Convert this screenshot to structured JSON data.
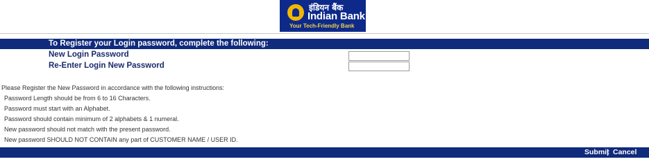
{
  "header": {
    "logo_hindi": "इंडियन बैंक",
    "logo_name": "Indian Bank",
    "logo_tagline": "Your Tech-Friendly Bank"
  },
  "form": {
    "title": "To Register your Login password, complete the following:",
    "new_password_label": "New Login Password",
    "new_password_value": "",
    "reenter_password_label": "Re-Enter Login New Password",
    "reenter_password_value": ""
  },
  "instructions": {
    "intro": "Please Register the New Password in accordance with the following instructions:",
    "items": [
      "Password Length should be from 6 to 16 Characters.",
      "Password must start with an Alphabet.",
      "Password should contain minimum of 2 alphabets & 1 numeral.",
      "New password should not match with the present password.",
      "New password SHOULD NOT CONTAIN any part of CUSTOMER NAME / USER ID."
    ]
  },
  "footer": {
    "submit_label": "Submit",
    "separator": "|",
    "cancel_label": "Cancel"
  },
  "colors": {
    "brand_blue": "#102a7c",
    "logo_yellow": "#f2b705"
  }
}
